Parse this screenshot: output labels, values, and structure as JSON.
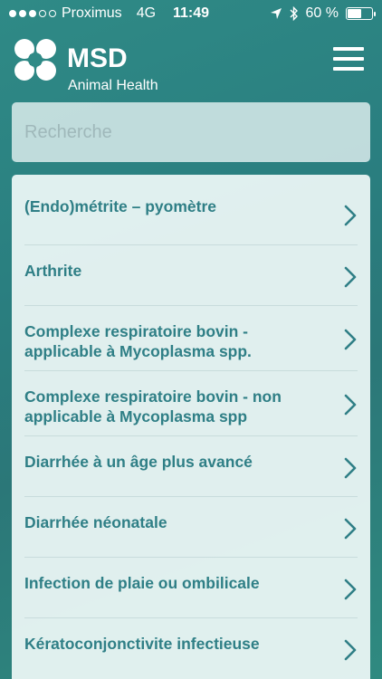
{
  "status_bar": {
    "carrier": "Proximus",
    "network": "4G",
    "time": "11:49",
    "battery_percent": "60 %",
    "battery_level": 0.6
  },
  "header": {
    "brand": "MSD",
    "brand_sub": "Animal Health",
    "logo_icon": "msd-logo-icon",
    "menu_icon": "hamburger-menu-icon"
  },
  "search": {
    "placeholder": "Recherche",
    "value": ""
  },
  "list": {
    "items": [
      {
        "label": "(Endo)métrite – pyomètre"
      },
      {
        "label": "Arthrite"
      },
      {
        "label": "Complexe respiratoire bovin - applicable à Mycoplasma spp."
      },
      {
        "label": "Complexe respiratoire bovin - non applicable à Mycoplasma spp"
      },
      {
        "label": "Diarrhée à un âge plus avancé"
      },
      {
        "label": "Diarrhée néonatale"
      },
      {
        "label": "Infection de plaie ou ombilicale"
      },
      {
        "label": "Kératoconjonctivite infectieuse"
      }
    ]
  },
  "colors": {
    "background": "#2b7f80",
    "list_text": "#2f7f86",
    "list_background": "#eaf5f4"
  }
}
